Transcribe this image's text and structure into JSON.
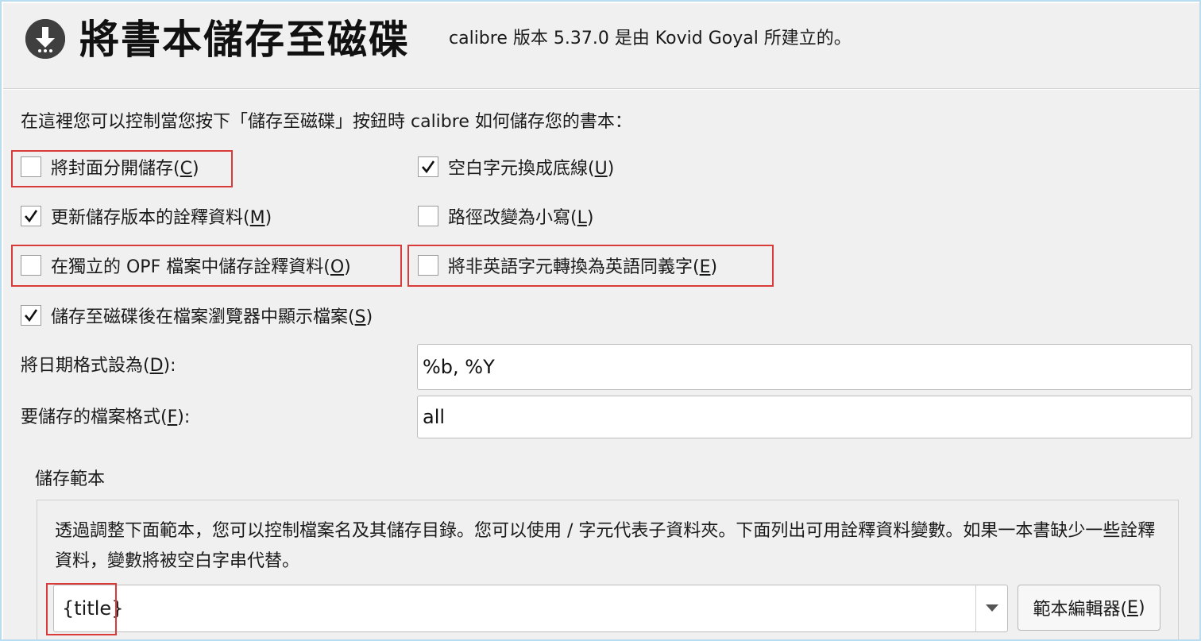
{
  "header": {
    "title": "將書本儲存至磁碟",
    "version_text": "calibre 版本 5.37.0 是由 Kovid Goyal 所建立的。"
  },
  "intro": "在這裡您可以控制當您按下「儲存至磁碟」按鈕時 calibre 如何儲存您的書本：",
  "options": {
    "save_cover": {
      "label": "將封面分開儲存(",
      "key": "C",
      "close": ")",
      "checked": false
    },
    "replace_space": {
      "label": "空白字元換成底線(",
      "key": "U",
      "close": ")",
      "checked": true
    },
    "update_metadata": {
      "label": "更新儲存版本的詮釋資料(",
      "key": "M",
      "close": ")",
      "checked": true
    },
    "lowercase_path": {
      "label": "路徑改變為小寫(",
      "key": "L",
      "close": ")",
      "checked": false
    },
    "save_opf": {
      "label": "在獨立的 OPF 檔案中儲存詮釋資料(",
      "key": "O",
      "close": ")",
      "checked": false
    },
    "asciiize": {
      "label": "將非英語字元轉換為英語同義字(",
      "key": "E",
      "close": ")",
      "checked": false
    },
    "show_in_browser": {
      "label": "儲存至磁碟後在檔案瀏覽器中顯示檔案(",
      "key": "S",
      "close": ")",
      "checked": true
    }
  },
  "date_format": {
    "label": "將日期格式設為(",
    "key": "D",
    "close": "):",
    "value": "%b, %Y"
  },
  "file_formats": {
    "label": "要儲存的檔案格式(",
    "key": "F",
    "close": "):",
    "value": "all"
  },
  "template_group": {
    "title": "儲存範本",
    "description": "透過調整下面範本，您可以控制檔案名及其儲存目錄。您可以使用 / 字元代表子資料夾。下面列出可用詮釋資料變數。如果一本書缺少一些詮釋資料，變數將被空白字串代替。",
    "template_value": "{title}",
    "editor_button": {
      "label": "範本編輯器(",
      "key": "E",
      "close": ")"
    }
  },
  "colors": {
    "highlight": "#d93a3a",
    "window_border": "#b9dcef"
  }
}
